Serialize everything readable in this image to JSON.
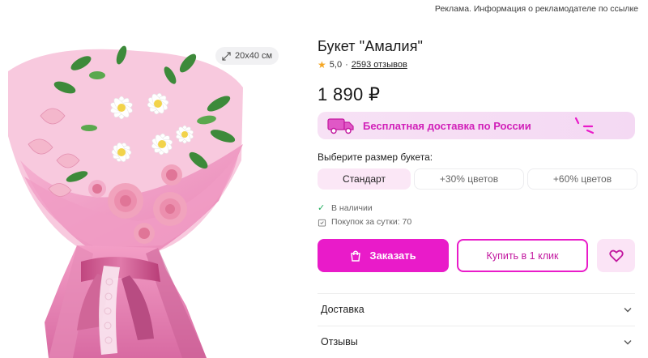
{
  "ad_note": "Реклама. Информация о рекламодателе по ссылке",
  "product": {
    "size_chip": "20x40 см",
    "title": "Букет \"Амалия\"",
    "rating": "5,0",
    "rating_separator": "·",
    "reviews": "2593 отзывов",
    "price": "1 890 ₽"
  },
  "delivery_banner": {
    "text": "Бесплатная доставка по России",
    "icon": "truck-icon"
  },
  "bouquet_size": {
    "label": "Выберите размер букета:",
    "options": [
      {
        "label": "Стандарт",
        "selected": true
      },
      {
        "label": "+30% цветов",
        "selected": false
      },
      {
        "label": "+60% цветов",
        "selected": false
      }
    ]
  },
  "status": {
    "in_stock": "В наличии",
    "purchases": "Покупок за сутки: 70"
  },
  "actions": {
    "order": "Заказать",
    "one_click": "Купить в 1 клик",
    "favorite_icon": "heart-icon"
  },
  "accordion": [
    {
      "label": "Доставка"
    },
    {
      "label": "Отзывы"
    }
  ],
  "colors": {
    "accent": "#e91bc9",
    "banner_bg": "#f7e1f5",
    "banner_text": "#d121b9",
    "star": "#f5a623",
    "in_stock": "#1fae5c"
  }
}
